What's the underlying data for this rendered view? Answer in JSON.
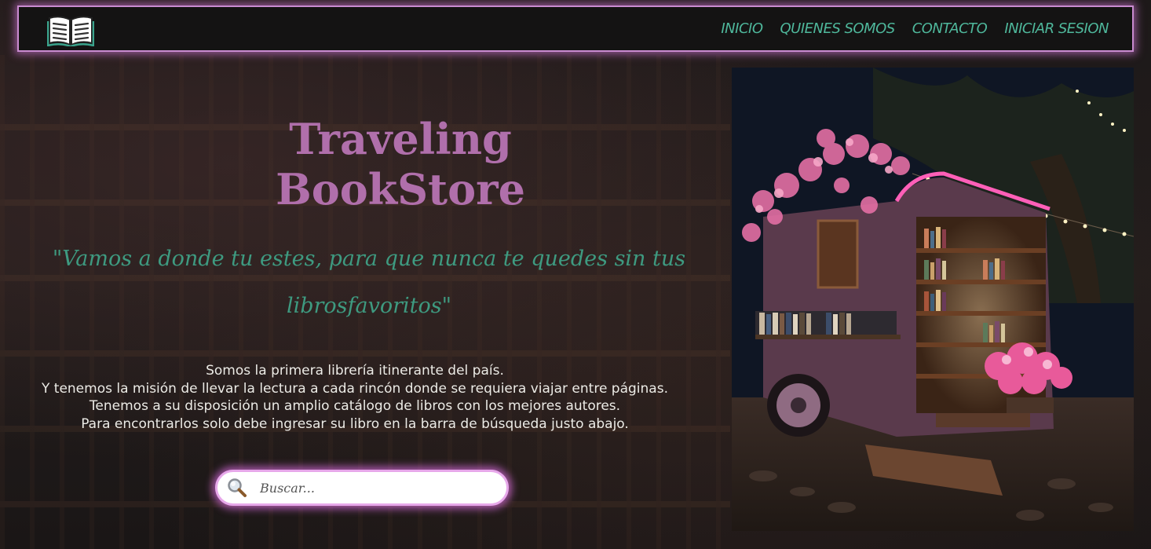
{
  "nav": {
    "logo_icon": "open-book-icon",
    "links": [
      "INICIO",
      "QUIENES SOMOS",
      "CONTACTO",
      "INICIAR SESION"
    ]
  },
  "hero": {
    "title_line1": "Traveling",
    "title_line2": "BookStore",
    "slogan": "\"Vamos a donde tu estes, para que nunca te quedes sin tus librosfavoritos\"",
    "description": [
      "Somos la primera librería itinerante del país.",
      "Y tenemos la misión de llevar la lectura a cada rincón donde se requiera viajar entre páginas.",
      "Tenemos a su disposición un amplio catálogo de libros con los mejores autores.",
      "Para encontrarlos solo debe ingresar su libro en la barra de búsqueda justo abajo."
    ]
  },
  "search": {
    "placeholder": "Buscar...",
    "icon": "magnifier-icon"
  },
  "image": {
    "icon": "bookstore-trailer-illustration"
  },
  "colors": {
    "accent_pink": "#c98bd0",
    "title_purple": "#b06fab",
    "link_teal": "#4fb89c",
    "slogan_teal": "#3e9a80",
    "background": "#1a1718"
  }
}
